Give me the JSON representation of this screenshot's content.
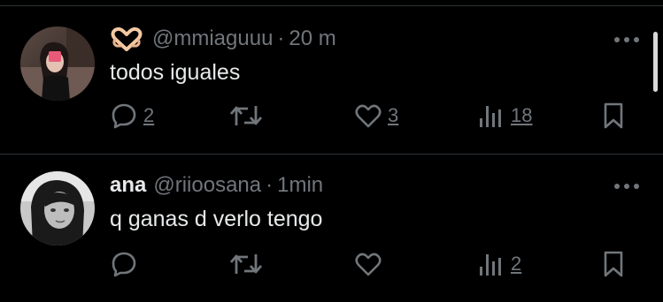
{
  "colors": {
    "background": "#000000",
    "text_primary": "#e7e9ea",
    "text_secondary": "#71767b",
    "divider": "#2f3336"
  },
  "tweets": [
    {
      "display_name": "",
      "name_emoji": "heart-hands-emoji",
      "handle": "@mmiaguuu",
      "separator": "·",
      "time": "20 m",
      "text": "todos iguales",
      "reply_count": "2",
      "retweet_count": "",
      "like_count": "3",
      "view_count": "18"
    },
    {
      "display_name": "ana",
      "handle": "@riioosana",
      "separator": "·",
      "time": "1min",
      "text": "q ganas d verlo tengo",
      "reply_count": "",
      "retweet_count": "",
      "like_count": "",
      "view_count": "2"
    }
  ],
  "icons": {
    "reply": "reply-icon",
    "retweet": "retweet-icon",
    "like": "heart-icon",
    "views": "views-chart-icon",
    "bookmark": "bookmark-icon",
    "more": "more-dots-icon"
  }
}
